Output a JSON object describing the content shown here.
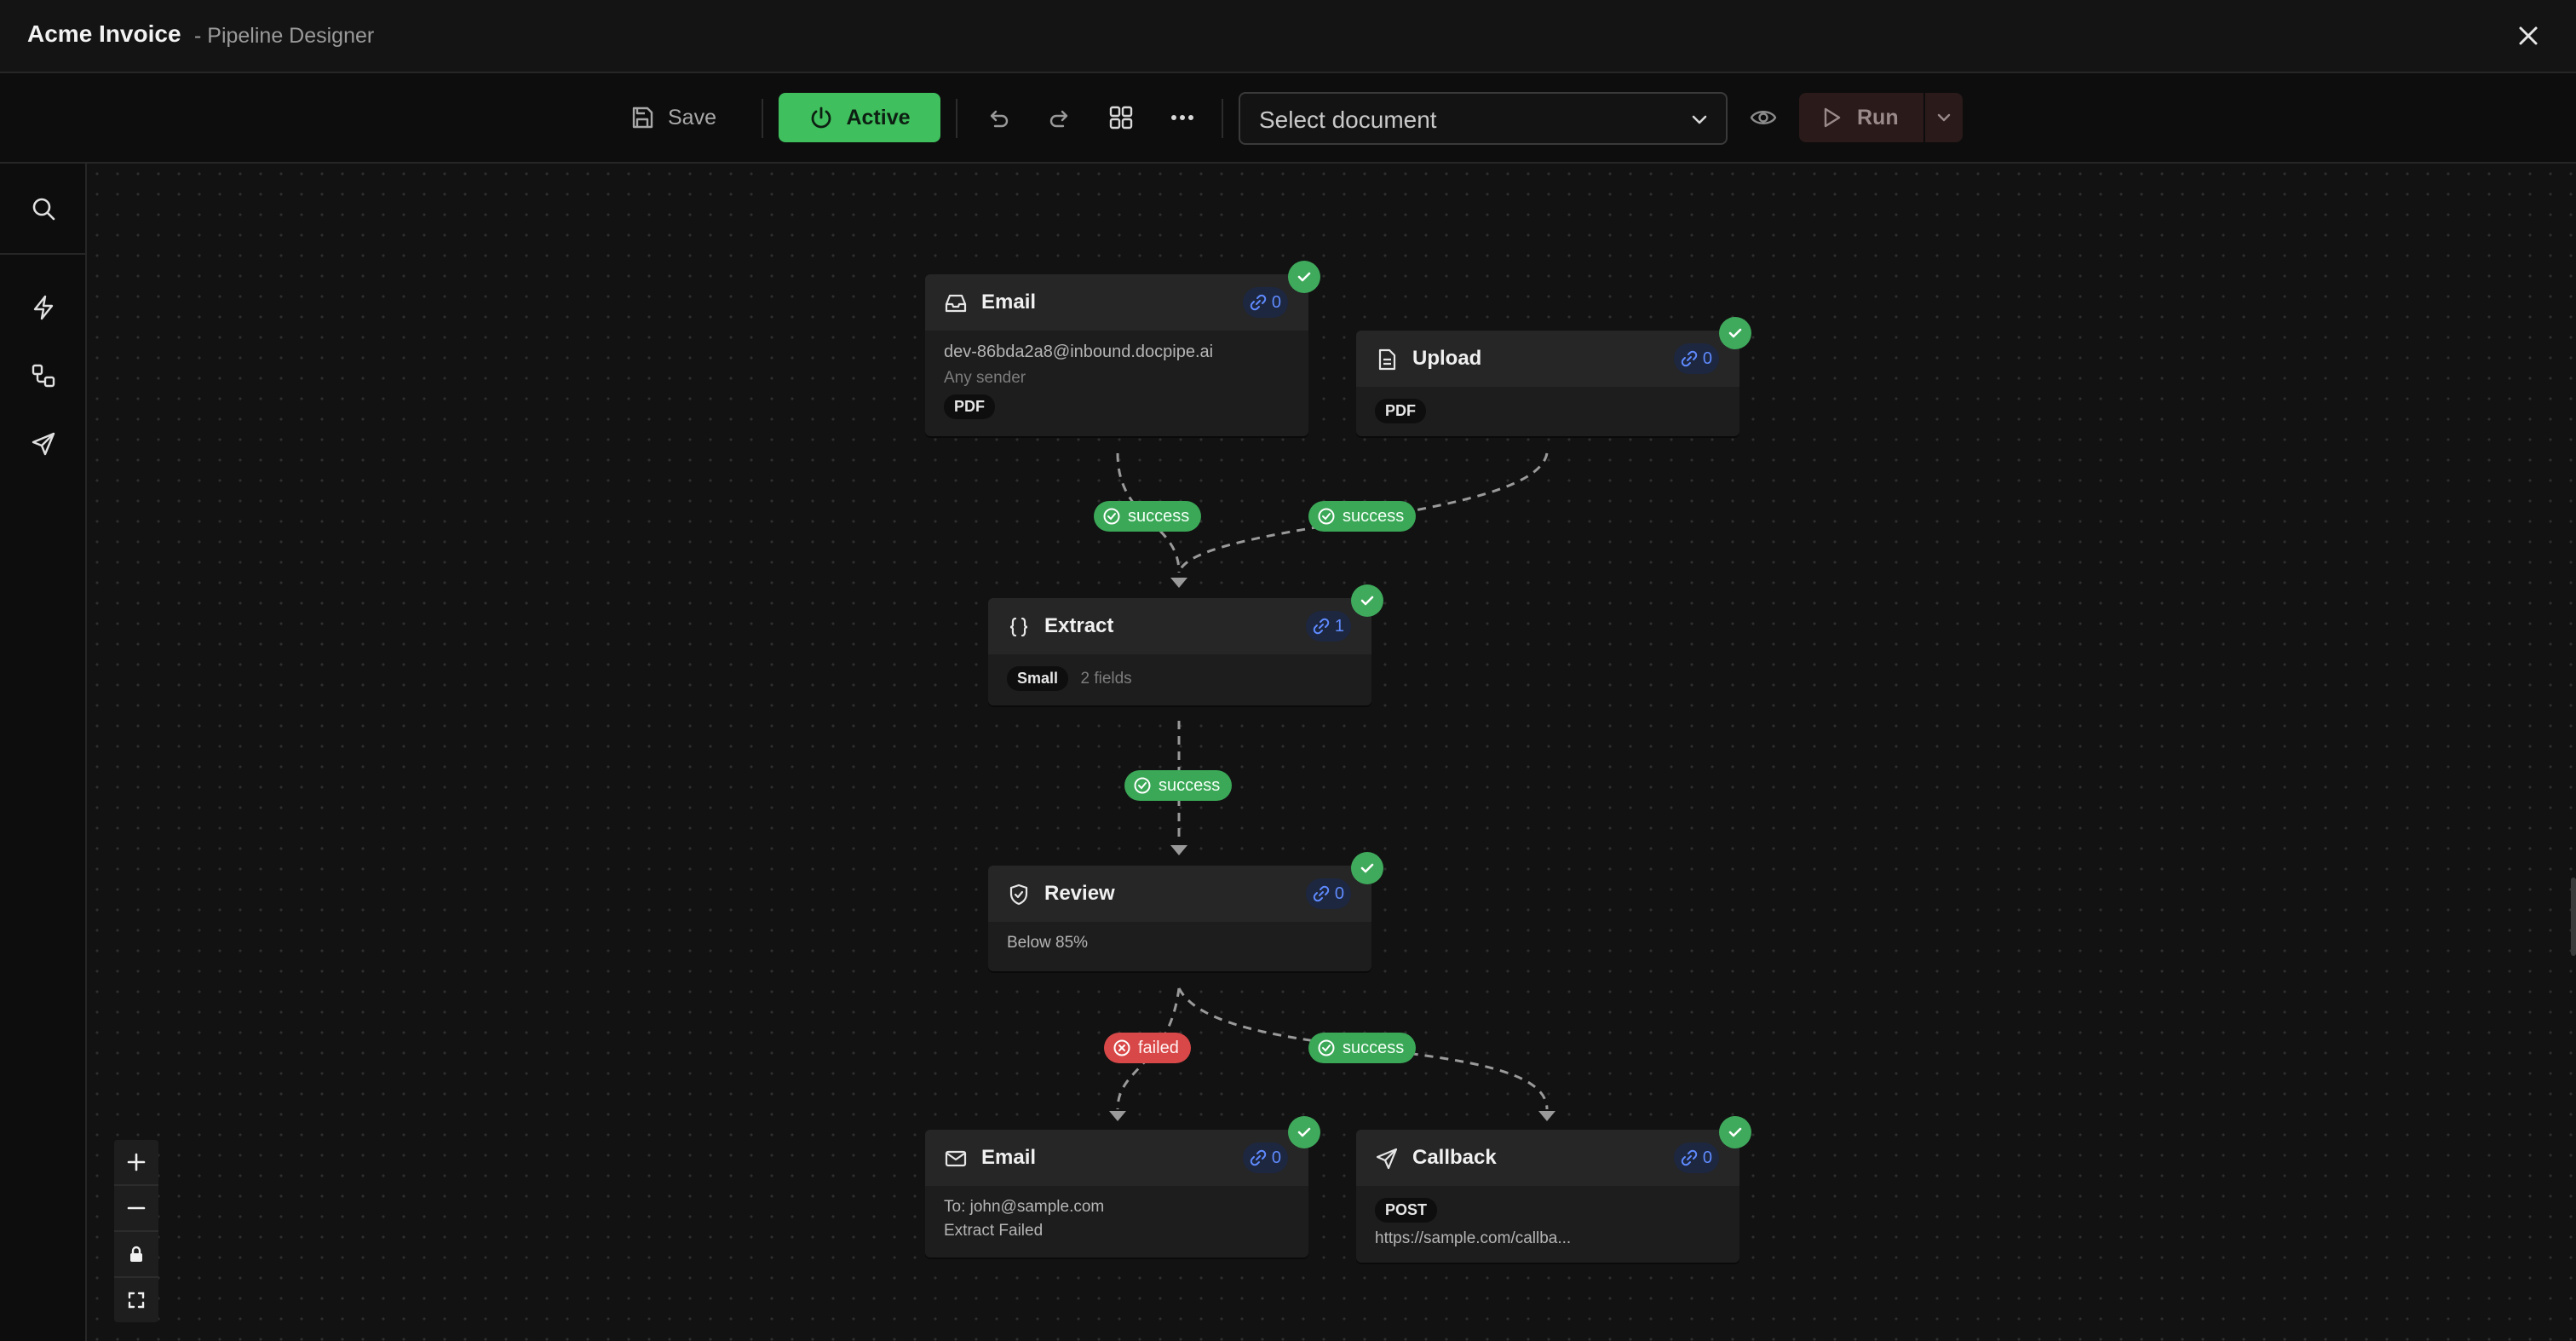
{
  "window": {
    "title": "Acme Invoice",
    "subtitle": "- Pipeline Designer"
  },
  "toolbar": {
    "save_label": "Save",
    "active_label": "Active",
    "select_placeholder": "Select document",
    "run_label": "Run"
  },
  "nodes": {
    "email_in": {
      "title": "Email",
      "link_count": "0",
      "address": "dev-86bda2a8@inbound.docpipe.ai",
      "sender": "Any sender",
      "tag": "PDF"
    },
    "upload": {
      "title": "Upload",
      "link_count": "0",
      "tag": "PDF"
    },
    "extract": {
      "title": "Extract",
      "link_count": "1",
      "tag": "Small",
      "fields": "2 fields"
    },
    "review": {
      "title": "Review",
      "link_count": "0",
      "threshold": "Below 85%"
    },
    "email_out": {
      "title": "Email",
      "link_count": "0",
      "to": "To: john@sample.com",
      "message": "Extract Failed"
    },
    "callback": {
      "title": "Callback",
      "link_count": "0",
      "method": "POST",
      "url": "https://sample.com/callba..."
    }
  },
  "edges": {
    "email_to_extract": "success",
    "upload_to_extract": "success",
    "extract_to_review": "success",
    "review_to_email": "failed",
    "review_to_callback": "success"
  },
  "colors": {
    "accent_green": "#3fbf5d",
    "success_green": "#3aa857",
    "failed_red": "#d94848",
    "link_blue": "#5f8bff"
  },
  "icons": {
    "titlebar": [
      "close-icon"
    ],
    "toolbar": [
      "save-icon",
      "power-icon",
      "undo-icon",
      "redo-icon",
      "grid-icon",
      "more-icon",
      "chevron-down-icon",
      "eye-icon",
      "play-icon"
    ],
    "rail": [
      "search-icon",
      "lightning-icon",
      "nodes-icon",
      "send-icon"
    ],
    "zoom": [
      "plus-icon",
      "minus-icon",
      "lock-icon",
      "fit-view-icon"
    ]
  }
}
